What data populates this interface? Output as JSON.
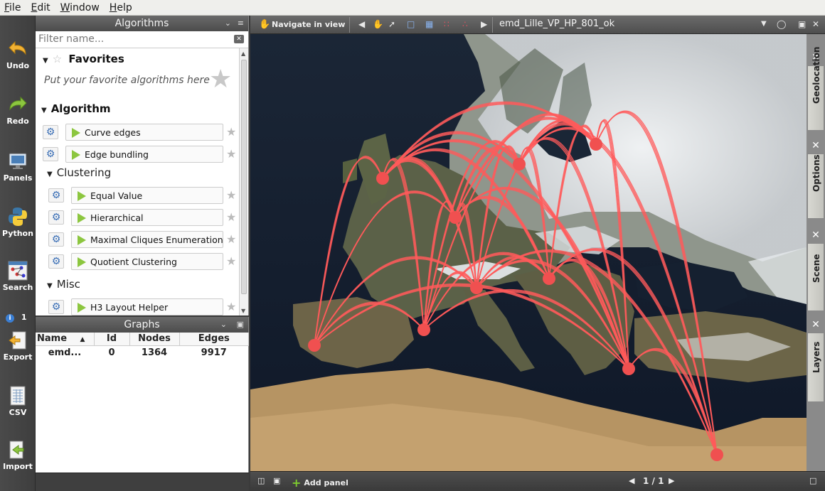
{
  "menu": {
    "items": [
      {
        "mnemonic": "F",
        "rest": "ile"
      },
      {
        "mnemonic": "E",
        "rest": "dit"
      },
      {
        "mnemonic": "W",
        "rest": "indow"
      },
      {
        "mnemonic": "H",
        "rest": "elp"
      }
    ]
  },
  "toolbar": {
    "undo": "Undo",
    "redo": "Redo",
    "panels": "Panels",
    "python": "Python",
    "search": "Search",
    "info_count": "1",
    "export": "Export",
    "csv": "CSV",
    "import": "Import"
  },
  "algorithms": {
    "title": "Algorithms",
    "filter_placeholder": "Filter name...",
    "favorites_title": "Favorites",
    "favorites_hint": "Put your favorite algorithms here",
    "algorithm_title": "Algorithm",
    "top_items": [
      "Curve edges",
      "Edge bundling"
    ],
    "clustering_title": "Clustering",
    "clustering_items": [
      "Equal Value",
      "Hierarchical",
      "Maximal Cliques Enumeration",
      "Quotient Clustering"
    ],
    "misc_title": "Misc",
    "misc_items": [
      "H3 Layout Helper"
    ]
  },
  "graphs": {
    "title": "Graphs",
    "columns": [
      "Name",
      "Id",
      "Nodes",
      "Edges"
    ],
    "rows": [
      {
        "name": "emd...",
        "id": "0",
        "nodes": "1364",
        "edges": "9917"
      }
    ]
  },
  "view": {
    "navigate_label": "Navigate in view",
    "title": "emd_Lille_VP_HP_801_ok",
    "add_panel": "Add panel",
    "pager": "1 / 1"
  },
  "side_tabs": [
    "Geolocation",
    "Options",
    "Scene",
    "Layers"
  ],
  "colors": {
    "edge": "#ff5a5a",
    "node": "#f05050",
    "accent_green": "#8cc63f"
  }
}
